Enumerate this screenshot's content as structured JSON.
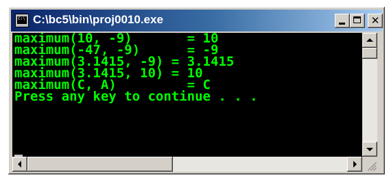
{
  "window": {
    "title": "C:\\bc5\\bin\\proj0010.exe",
    "icon": "console-app-icon",
    "icon_text": "C:\\",
    "buttons": [
      "minimize",
      "maximize",
      "close"
    ],
    "close_glyph": "✕"
  },
  "console": {
    "text_color": "#00ff00",
    "background": "#000000",
    "lines": [
      "maximum(10, -9)       = 10",
      "maximum(-47, -9)      = -9",
      "maximum(3.1415, -9) = 3.1415",
      "maximum(3.1415, 10) = 10",
      "maximum(C, A)         = C",
      "Press any key to continue . . ."
    ]
  },
  "colors": {
    "title_gradient_start": "#0a246a",
    "title_gradient_end": "#a6caf0",
    "chrome": "#d4d0c8"
  }
}
